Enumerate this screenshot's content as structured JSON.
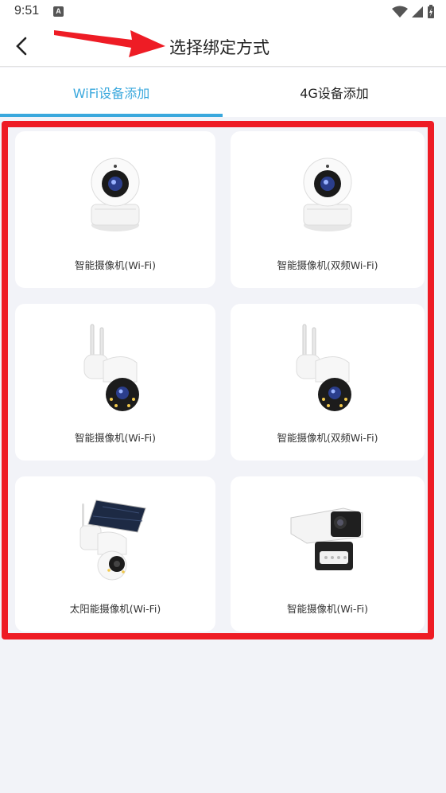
{
  "status_bar": {
    "time": "9:51",
    "notification_glyph": "A",
    "icons": [
      "wifi-icon",
      "signal-icon",
      "battery-charging-icon"
    ]
  },
  "header": {
    "back_icon": "chevron-left-icon",
    "title": "选择绑定方式"
  },
  "tabs": [
    {
      "label": "WiFi设备添加",
      "active": true
    },
    {
      "label": "4G设备添加",
      "active": false
    }
  ],
  "devices": [
    {
      "label": "智能摄像机(Wi-Fi)",
      "image": "indoor-dome-camera-icon"
    },
    {
      "label": "智能摄像机(双频Wi-Fi)",
      "image": "indoor-dome-camera-icon"
    },
    {
      "label": "智能摄像机(Wi-Fi)",
      "image": "outdoor-ptz-camera-icon"
    },
    {
      "label": "智能摄像机(双频Wi-Fi)",
      "image": "outdoor-ptz-camera-icon"
    },
    {
      "label": "太阳能摄像机(Wi-Fi)",
      "image": "solar-camera-icon"
    },
    {
      "label": "智能摄像机(Wi-Fi)",
      "image": "bullet-camera-icon"
    }
  ],
  "colors": {
    "accent": "#3aa8dd",
    "background": "#f2f3f8",
    "annotation_red": "#ee1c25"
  }
}
